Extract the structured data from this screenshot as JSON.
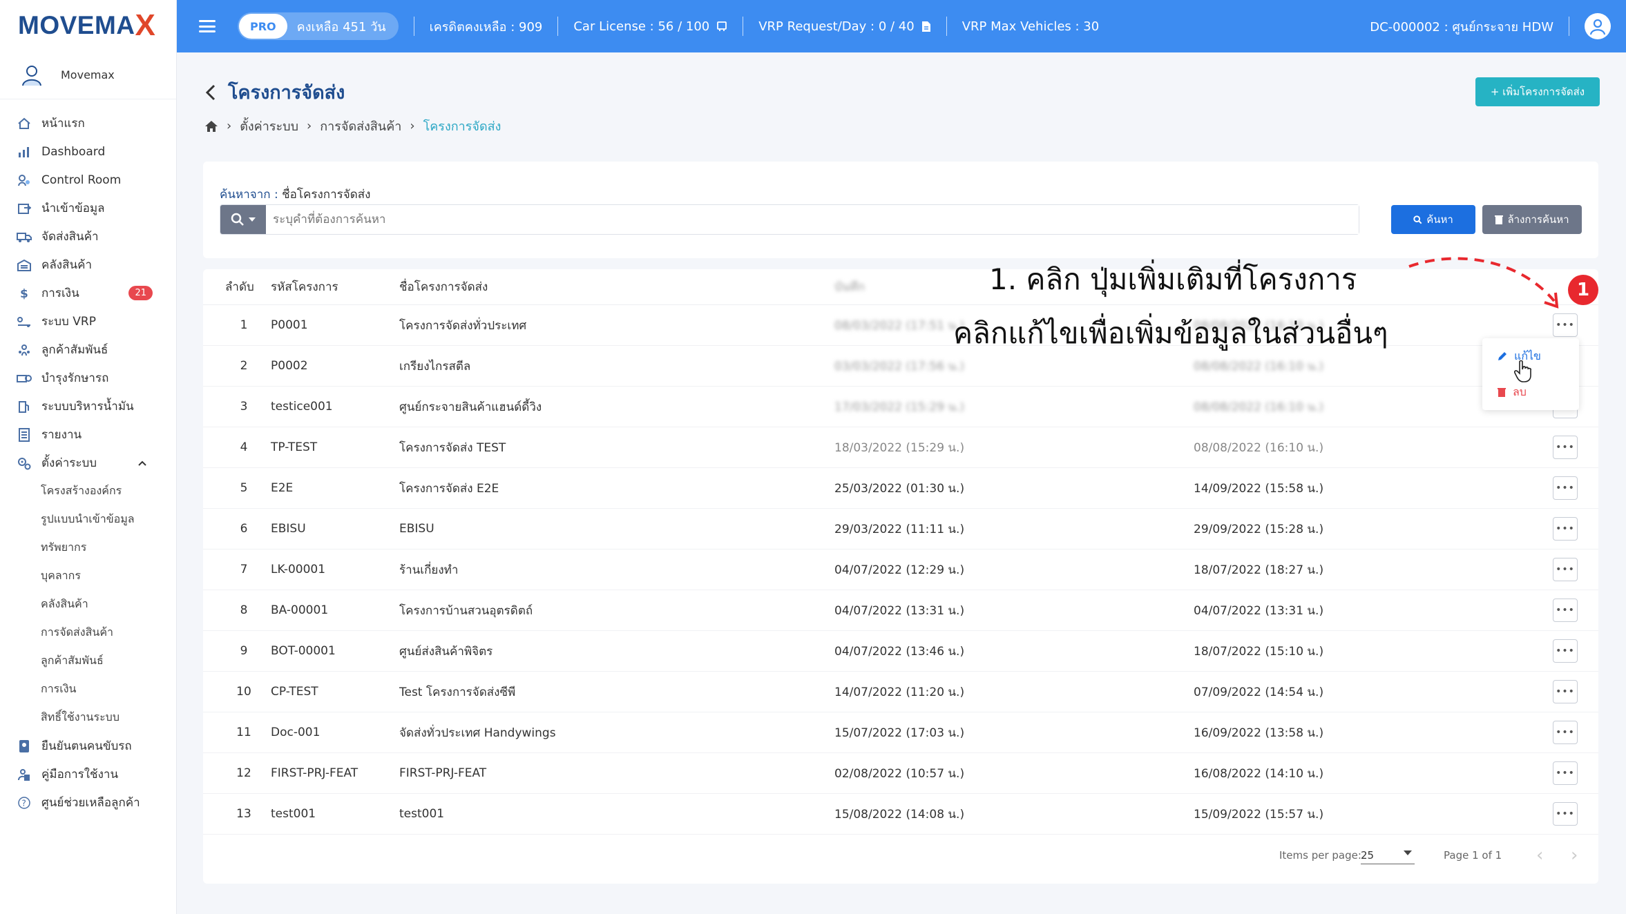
{
  "brand": {
    "logo_main": "MOVEMA",
    "logo_x": "X"
  },
  "user": {
    "name": "Movemax"
  },
  "sidebar": {
    "items": [
      {
        "label": "หน้าแรก",
        "icon": "home-icon"
      },
      {
        "label": "Dashboard",
        "icon": "chart-icon"
      },
      {
        "label": "Control Room",
        "icon": "control-room-icon"
      },
      {
        "label": "นำเข้าข้อมูล",
        "icon": "import-icon"
      },
      {
        "label": "จัดส่งสินค้า",
        "icon": "truck-icon"
      },
      {
        "label": "คลังสินค้า",
        "icon": "warehouse-icon"
      },
      {
        "label": "การเงิน",
        "icon": "finance-icon",
        "badge": "21"
      },
      {
        "label": "ระบบ VRP",
        "icon": "vrp-icon"
      },
      {
        "label": "ลูกค้าสัมพันธ์",
        "icon": "crm-icon"
      },
      {
        "label": "บำรุงรักษารถ",
        "icon": "maintenance-icon"
      },
      {
        "label": "ระบบบริหารน้ำมัน",
        "icon": "fuel-icon"
      },
      {
        "label": "รายงาน",
        "icon": "report-icon"
      },
      {
        "label": "ตั้งค่าระบบ",
        "icon": "settings-icon"
      }
    ],
    "submenu": [
      "โครงสร้างองค์กร",
      "รูปแบบนำเข้าข้อมูล",
      "ทรัพยากร",
      "บุคลากร",
      "คลังสินค้า",
      "การจัดส่งสินค้า",
      "ลูกค้าสัมพันธ์",
      "การเงิน",
      "สิทธิ์ใช้งานระบบ"
    ],
    "bottom_items": [
      {
        "label": "ยืนยันตนคนขับรถ",
        "icon": "driver-verify-icon"
      },
      {
        "label": "คู่มือการใช้งาน",
        "icon": "manual-icon"
      },
      {
        "label": "ศูนย์ช่วยเหลือลูกค้า",
        "icon": "help-icon"
      }
    ]
  },
  "header": {
    "pro_tag": "PRO",
    "pro_remaining": "คงเหลือ 451 วัน",
    "credit": "เครดิตคงเหลือ : 909",
    "car_license": "Car License : 56 / 100",
    "vrp_request": "VRP Request/Day : 0 / 40",
    "vrp_max": "VRP Max Vehicles : 30",
    "dc": "DC-000002 : ศูนย์กระจาย HDW"
  },
  "page": {
    "title": "โครงการจัดส่ง",
    "add_button": "+ เพิ่มโครงการจัดส่ง",
    "breadcrumb": [
      "ตั้งค่าระบบ",
      "การจัดส่งสินค้า",
      "โครงการจัดส่ง"
    ]
  },
  "search": {
    "label_prefix": "ค้นหาจาก : ",
    "label_field": "ชื่อโครงการจัดส่ง",
    "placeholder": "ระบุคำที่ต้องการค้นหา",
    "search_button": "ค้นหา",
    "clear_button": "ล้างการค้นหา"
  },
  "table": {
    "headers": {
      "no": "ลำดับ",
      "code": "รหัสโครงการ",
      "name": "ชื่อโครงการจัดส่ง",
      "created": "บันทึก"
    },
    "rows": [
      {
        "no": "1",
        "code": "P0001",
        "name": "โครงการจัดส่งทั่วประเทศ",
        "created": "08/03/2022 (17:51 น.)",
        "updated": "08/08/2022 (16:10 น.)",
        "blurred": true
      },
      {
        "no": "2",
        "code": "P0002",
        "name": "เกรียงไกรสตีล",
        "created": "03/03/2022 (17:56 น.)",
        "updated": "08/08/2022 (16:10 น.)",
        "blurred": true
      },
      {
        "no": "3",
        "code": "testice001",
        "name": "ศูนย์กระจายสินค้าแฮนด์ดี้วิง",
        "created": "17/03/2022 (15:29 น.)",
        "updated": "08/08/2022 (16:10 น.)",
        "blurred": true
      },
      {
        "no": "4",
        "code": "TP-TEST",
        "name": "โครงการจัดส่ง TEST",
        "created": "18/03/2022 (15:29 น.)",
        "updated": "08/08/2022 (16:10 น.)",
        "faded": true
      },
      {
        "no": "5",
        "code": "E2E",
        "name": "โครงการจัดส่ง E2E",
        "created": "25/03/2022 (01:30 น.)",
        "updated": "14/09/2022 (15:58 น.)"
      },
      {
        "no": "6",
        "code": "EBISU",
        "name": "EBISU",
        "created": "29/03/2022 (11:11 น.)",
        "updated": "29/09/2022 (15:28 น.)"
      },
      {
        "no": "7",
        "code": "LK-00001",
        "name": "ร้านเกี่ยงทำ",
        "created": "04/07/2022 (12:29 น.)",
        "updated": "18/07/2022 (18:27 น.)"
      },
      {
        "no": "8",
        "code": "BA-00001",
        "name": "โครงการบ้านสวนอุตรดิตถ์",
        "created": "04/07/2022 (13:31 น.)",
        "updated": "04/07/2022 (13:31 น.)"
      },
      {
        "no": "9",
        "code": "BOT-00001",
        "name": "ศูนย์ส่งสินค้าพิจิตร",
        "created": "04/07/2022 (13:46 น.)",
        "updated": "18/07/2022 (15:10 น.)"
      },
      {
        "no": "10",
        "code": "CP-TEST",
        "name": "Test โครงการจัดส่งซีพี",
        "created": "14/07/2022 (11:20 น.)",
        "updated": "07/09/2022 (14:54 น.)"
      },
      {
        "no": "11",
        "code": "Doc-001",
        "name": "จัดส่งทั่วประเทศ Handywings",
        "created": "15/07/2022 (17:03 น.)",
        "updated": "16/09/2022 (13:58 น.)"
      },
      {
        "no": "12",
        "code": "FIRST-PRJ-FEAT",
        "name": "FIRST-PRJ-FEAT",
        "created": "02/08/2022 (10:57 น.)",
        "updated": "16/08/2022 (14:10 น.)"
      },
      {
        "no": "13",
        "code": "test001",
        "name": "test001",
        "created": "15/08/2022 (14:08 น.)",
        "updated": "15/09/2022 (15:57 น.)"
      }
    ],
    "more_label": "•••"
  },
  "dropdown": {
    "edit": "แก้ไข",
    "delete": "ลบ"
  },
  "annotation": {
    "line1": "1. คลิก ปุ่มเพิ่มเติมที่โครงการ",
    "line2": "คลิกแก้ไขเพื่อเพิ่มข้อมูลในส่วนอื่นๆ",
    "step": "1"
  },
  "pager": {
    "items_per_page_label": "Items per page:",
    "items_per_page_value": "25",
    "page_text": "Page 1 of 1"
  },
  "colors": {
    "header_bg": "#3d8cf1",
    "title": "#1f4d8f",
    "accent_teal": "#26b3c4",
    "primary": "#1c6fe0",
    "danger": "#e8484e"
  }
}
